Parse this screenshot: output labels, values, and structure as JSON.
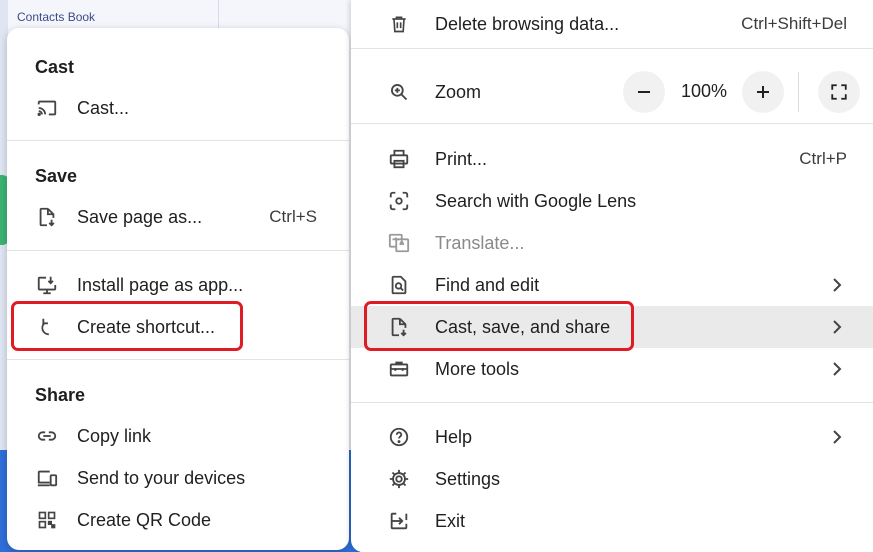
{
  "background": {
    "title": "Contacts Book"
  },
  "submenu": {
    "cast": {
      "heading": "Cast",
      "items": [
        {
          "label": "Cast...",
          "icon": "cast-icon"
        }
      ]
    },
    "save": {
      "heading": "Save",
      "items": [
        {
          "label": "Save page as...",
          "shortcut": "Ctrl+S",
          "icon": "save-page-icon"
        },
        {
          "label": "Install page as app...",
          "icon": "install-app-icon"
        },
        {
          "label": "Create shortcut...",
          "icon": "shortcut-icon"
        }
      ]
    },
    "share": {
      "heading": "Share",
      "items": [
        {
          "label": "Copy link",
          "icon": "link-icon"
        },
        {
          "label": "Send to your devices",
          "icon": "devices-icon"
        },
        {
          "label": "Create QR Code",
          "icon": "qr-code-icon"
        }
      ]
    }
  },
  "main_menu": {
    "delete_browsing": {
      "label": "Delete browsing data...",
      "shortcut": "Ctrl+Shift+Del",
      "icon": "trash-icon"
    },
    "zoom": {
      "label": "Zoom",
      "value": "100%",
      "icon": "zoom-icon",
      "minus": "−",
      "plus": "+"
    },
    "print": {
      "label": "Print...",
      "shortcut": "Ctrl+P",
      "icon": "print-icon"
    },
    "lens": {
      "label": "Search with Google Lens",
      "icon": "lens-icon"
    },
    "translate": {
      "label": "Translate...",
      "icon": "translate-icon",
      "disabled": true
    },
    "find_edit": {
      "label": "Find and edit",
      "icon": "find-page-icon"
    },
    "cast_save_share": {
      "label": "Cast, save, and share",
      "icon": "save-page-icon"
    },
    "more_tools": {
      "label": "More tools",
      "icon": "toolbox-icon"
    },
    "help": {
      "label": "Help",
      "icon": "help-icon"
    },
    "settings": {
      "label": "Settings",
      "icon": "gear-icon"
    },
    "exit": {
      "label": "Exit",
      "icon": "exit-icon"
    }
  },
  "colors": {
    "highlight": "#e01b24",
    "active_row": "#eaeaea",
    "menu_bg": "#ffffff"
  }
}
